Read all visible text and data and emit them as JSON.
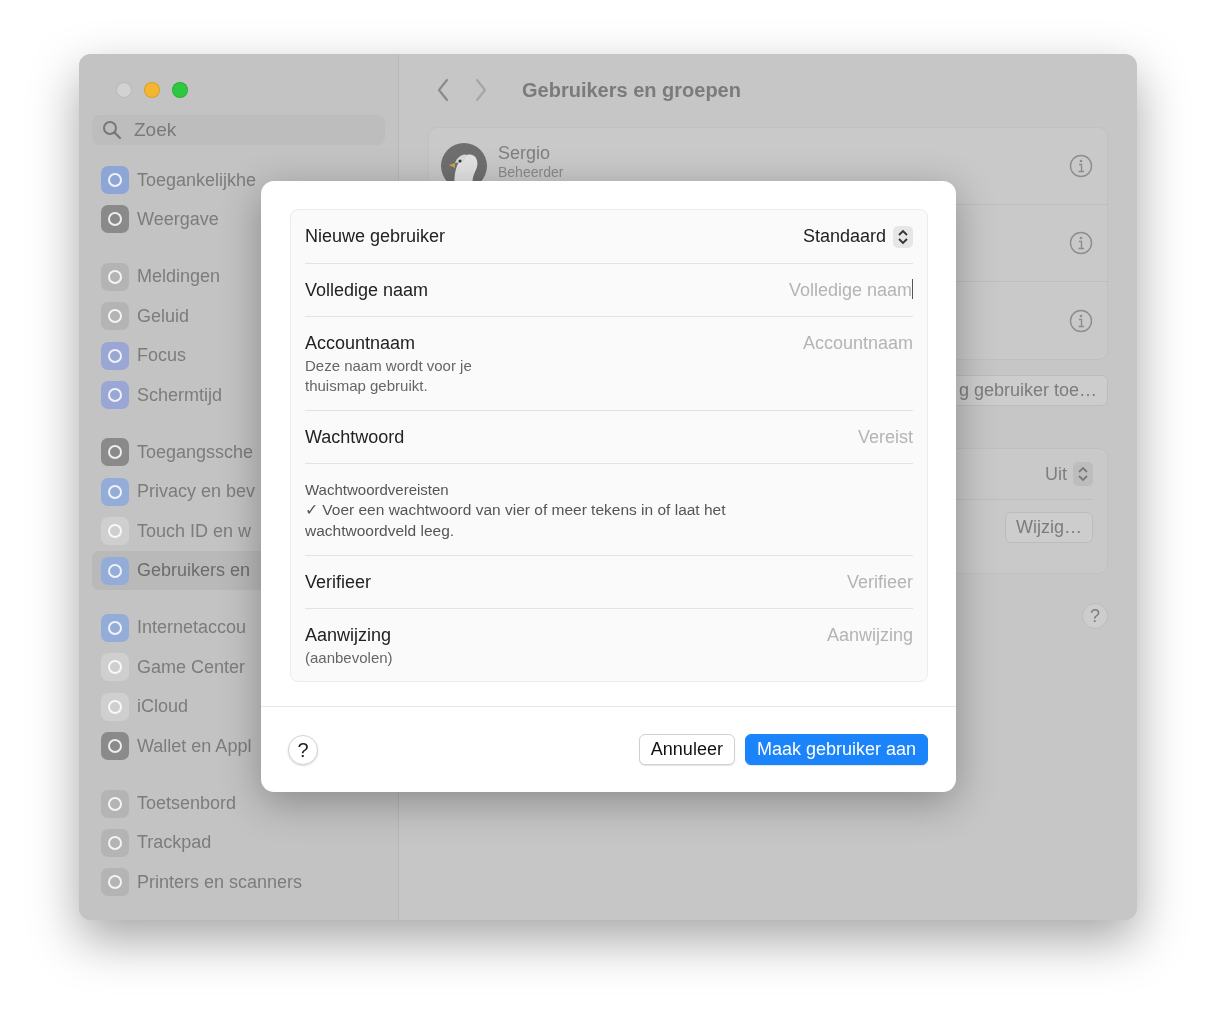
{
  "window": {
    "title": "Gebruikers en groepen",
    "traffic_lights": [
      {
        "color": "#d2d2d2"
      },
      {
        "color": "#f4b72f"
      },
      {
        "color": "#2ec840"
      }
    ]
  },
  "search": {
    "placeholder": "Zoek"
  },
  "sidebar": {
    "groups": [
      {
        "items": [
          {
            "label": "Toegankelijkhe",
            "color": "#8ea6d6",
            "selected": false
          },
          {
            "label": "Weergave",
            "color": "#8a8a8a",
            "selected": false
          }
        ]
      },
      {
        "items": [
          {
            "label": "Meldingen",
            "color": "#b4b4b4",
            "selected": false
          },
          {
            "label": "Geluid",
            "color": "#b4b4b4",
            "selected": false
          },
          {
            "label": "Focus",
            "color": "#9aa6d4",
            "selected": false
          },
          {
            "label": "Schermtijd",
            "color": "#9aa6d4",
            "selected": false
          }
        ]
      },
      {
        "items": [
          {
            "label": "Toegangssche",
            "color": "#8a8a8a",
            "selected": false
          },
          {
            "label": "Privacy en bev",
            "color": "#93acd8",
            "selected": false
          },
          {
            "label": "Touch ID en w",
            "color": "#cfcfcf",
            "selected": false
          },
          {
            "label": "Gebruikers en",
            "color": "#93acd8",
            "selected": true
          }
        ]
      },
      {
        "items": [
          {
            "label": "Internetaccou",
            "color": "#93acd8",
            "selected": false
          },
          {
            "label": "Game Center",
            "color": "#cfcfcf",
            "selected": false
          },
          {
            "label": "iCloud",
            "color": "#cfcfcf",
            "selected": false
          },
          {
            "label": "Wallet en Appl",
            "color": "#8a8a8a",
            "selected": false
          }
        ]
      },
      {
        "items": [
          {
            "label": "Toetsenbord",
            "color": "#b4b4b4",
            "selected": false
          },
          {
            "label": "Trackpad",
            "color": "#b4b4b4",
            "selected": false
          },
          {
            "label": "Printers en scanners",
            "color": "#b4b4b4",
            "selected": false
          }
        ]
      }
    ]
  },
  "user_rows": [
    {
      "kind": "user",
      "name": "Sergio",
      "role": "Beheerder"
    },
    {
      "kind": "covered"
    },
    {
      "kind": "covered"
    }
  ],
  "add_user_button": "g gebruiker toe…",
  "settings_card": {
    "select_value": "Uit",
    "button": "Wijzig…"
  },
  "help_button": "?",
  "dialog": {
    "rows": [
      {
        "kind": "popup",
        "label": "Nieuwe gebruiker",
        "value": "Standaard"
      },
      {
        "kind": "field",
        "label": "Volledige naam",
        "placeholder": "Volledige naam",
        "focused": true
      },
      {
        "kind": "field",
        "label": "Accountnaam",
        "note": "Deze naam wordt voor je thuismap gebruikt.",
        "placeholder": "Accountnaam",
        "focused": false
      },
      {
        "kind": "field",
        "label": "Wachtwoord",
        "placeholder": "Vereist",
        "focused": false
      },
      {
        "kind": "info",
        "title": "Wachtwoordvereisten",
        "text": "✓ Voer een wachtwoord van vier of meer tekens in of laat het wachtwoordveld leeg."
      },
      {
        "kind": "field",
        "label": "Verifieer",
        "placeholder": "Verifieer",
        "focused": false
      },
      {
        "kind": "field",
        "label": "Aanwijzing",
        "note": "(aanbevolen)",
        "placeholder": "Aanwijzing",
        "focused": false
      }
    ],
    "help": "?",
    "buttons": [
      {
        "label": "Annuleer",
        "primary": false
      },
      {
        "label": "Maak gebruiker aan",
        "primary": true
      }
    ]
  }
}
